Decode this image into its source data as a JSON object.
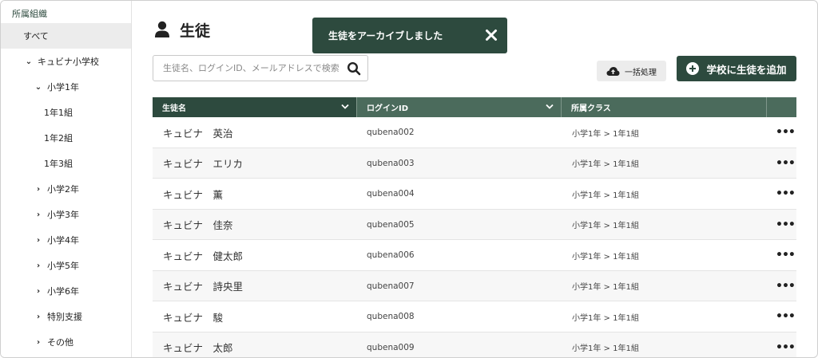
{
  "sidebar": {
    "title": "所属組織",
    "items": [
      {
        "label": "すべて",
        "chevron": "",
        "selected": true
      },
      {
        "label": "キュビナ小学校",
        "chevron": "down"
      },
      {
        "label": "小学1年",
        "chevron": "down"
      },
      {
        "label": "1年1組",
        "chevron": ""
      },
      {
        "label": "1年2組",
        "chevron": ""
      },
      {
        "label": "1年3組",
        "chevron": ""
      },
      {
        "label": "小学2年",
        "chevron": "right"
      },
      {
        "label": "小学3年",
        "chevron": "right"
      },
      {
        "label": "小学4年",
        "chevron": "right"
      },
      {
        "label": "小学5年",
        "chevron": "right"
      },
      {
        "label": "小学6年",
        "chevron": "right"
      },
      {
        "label": "特別支援",
        "chevron": "right"
      },
      {
        "label": "その他",
        "chevron": "right"
      }
    ]
  },
  "header": {
    "title": "生徒",
    "icon": "person-icon"
  },
  "toast": {
    "message": "生徒をアーカイブしました",
    "close_icon": "close-icon"
  },
  "search": {
    "placeholder": "生徒名、ログインID、メールアドレスで検索",
    "value": ""
  },
  "toolbar": {
    "bulk_label": "一括処理",
    "add_label": "学校に生徒を追加"
  },
  "table": {
    "columns": [
      "生徒名",
      "ログインID",
      "所属クラス"
    ],
    "rows": [
      {
        "name": "キュビナ　英治",
        "login": "qubena002",
        "class": "小学1年 >  1年1組"
      },
      {
        "name": "キュビナ　エリカ",
        "login": "qubena003",
        "class": "小学1年 >  1年1組"
      },
      {
        "name": "キュビナ　薫",
        "login": "qubena004",
        "class": "小学1年 >  1年1組"
      },
      {
        "name": "キュビナ　佳奈",
        "login": "qubena005",
        "class": "小学1年 >  1年1組"
      },
      {
        "name": "キュビナ　健太郎",
        "login": "qubena006",
        "class": "小学1年 >  1年1組"
      },
      {
        "name": "キュビナ　詩央里",
        "login": "qubena007",
        "class": "小学1年 >  1年1組"
      },
      {
        "name": "キュビナ　駿",
        "login": "qubena008",
        "class": "小学1年 >  1年1組"
      },
      {
        "name": "キュビナ　太郎",
        "login": "qubena009",
        "class": "小学1年 >  1年1組"
      }
    ],
    "more_label": "•••"
  },
  "colors": {
    "accent": "#2d4a3e",
    "header_bg": "#4b6b5c",
    "selected_bg": "#ececec"
  }
}
